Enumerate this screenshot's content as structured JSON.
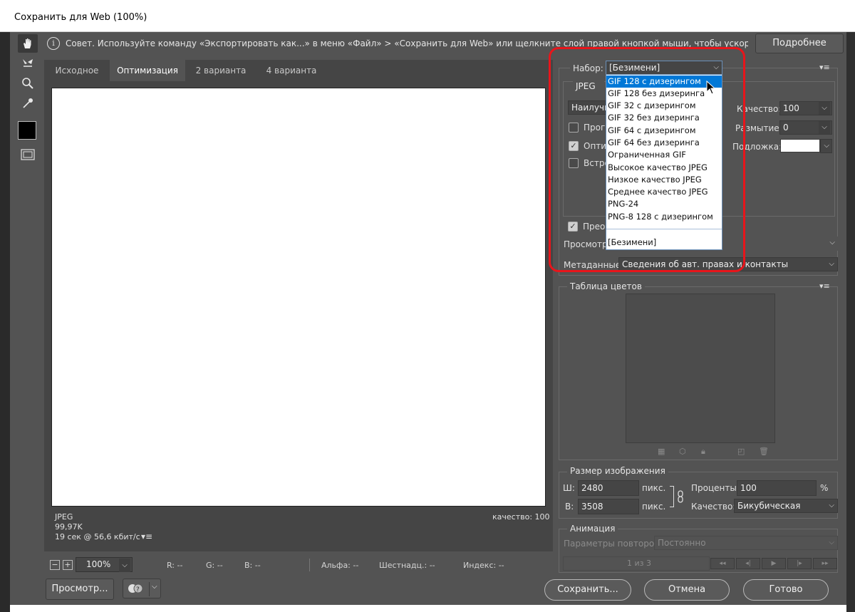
{
  "window": {
    "title": "Сохранить для Web (100%)"
  },
  "toolbar": {
    "tools": [
      {
        "icon": "hand-tool-icon",
        "glyph": "✋"
      },
      {
        "icon": "slice-select-tool-icon",
        "glyph": "⤡"
      },
      {
        "icon": "zoom-tool-icon",
        "glyph": "🔍"
      },
      {
        "icon": "eyedropper-tool-icon",
        "glyph": "✎"
      },
      {
        "icon": "eyedropper-color-swatch",
        "glyph": ""
      },
      {
        "icon": "toggle-slices-icon",
        "glyph": "▦"
      }
    ],
    "swatch_color": "#000000"
  },
  "tip": {
    "icon": "i",
    "text": "Совет. Используйте команду «Экспортировать как...» в меню «Файл» > «Сохранить для Web» или щелкните слой правой кнопкой мыши, чтобы ускорить экспорт ресурсов",
    "more_button": "Подробнее"
  },
  "tabs": [
    {
      "label": "Исходное",
      "active": false
    },
    {
      "label": "Оптимизация",
      "active": true
    },
    {
      "label": "2 варианта",
      "active": false
    },
    {
      "label": "4 варианта",
      "active": false
    }
  ],
  "canvas_info": {
    "format": "JPEG",
    "size": "99,97K",
    "download_time": "19 сек @ 56,6 кбит/с",
    "quality": "качество: 100"
  },
  "statusbar": {
    "zoom_minus": "−",
    "zoom_plus": "+",
    "zoom_value": "100%",
    "r": "R: --",
    "g": "G: --",
    "b": "B: --",
    "alpha": "Альфа: --",
    "hex": "Шестнадц.: --",
    "index": "Индекс: --"
  },
  "bottom_left": {
    "preview_button": "Просмотр...",
    "browser_icon": "browser-preview-icon"
  },
  "preset": {
    "label": "Набор:",
    "value": "[Безимени]",
    "format_value": "JPEG",
    "compression_value": "Наилучш",
    "quality_label": "Качество:",
    "quality_value": "100",
    "blur_label": "Размытие:",
    "blur_value": "0",
    "matte_label": "Подложка:",
    "matte_color": "#ffffff",
    "progressive_label": "Прогр",
    "optimized_label": "Оптим",
    "embed_label": "Встро",
    "convert_label": "Преоб",
    "preview_label": "Просмотр:",
    "metadata_label": "Метаданные:",
    "metadata_value": "Сведения об авт. правах и контакты"
  },
  "dropdown": {
    "options": [
      {
        "label": "GIF 128 с дизерингом",
        "highlighted": true
      },
      {
        "label": "GIF 128 без дизеринга",
        "highlighted": false
      },
      {
        "label": "GIF 32 с дизерингом",
        "highlighted": false
      },
      {
        "label": "GIF 32 без дизеринга",
        "highlighted": false
      },
      {
        "label": "GIF 64 с дизерингом",
        "highlighted": false
      },
      {
        "label": "GIF 64 без дизеринга",
        "highlighted": false
      },
      {
        "label": "Ограниченная GIF",
        "highlighted": false
      },
      {
        "label": "Высокое качество JPEG",
        "highlighted": false
      },
      {
        "label": "Низкое качество JPEG",
        "highlighted": false
      },
      {
        "label": "Среднее качество JPEG",
        "highlighted": false
      },
      {
        "label": "PNG-24",
        "highlighted": false
      },
      {
        "label": "PNG-8 128 с дизерингом",
        "highlighted": false
      }
    ],
    "footer": "[Безимени]"
  },
  "color_table": {
    "title": "Таблица цветов",
    "icons": [
      "web-shift-icon",
      "map-color-icon",
      "lock-color-icon",
      "new-color-icon",
      "trash-icon"
    ]
  },
  "image_size": {
    "title": "Размер изображения",
    "width_label": "Ш:",
    "width_value": "2480",
    "height_label": "В:",
    "height_value": "3508",
    "unit": "пикс.",
    "percent_label": "Проценты:",
    "percent_value": "100",
    "percent_sign": "%",
    "quality_label": "Качество:",
    "quality_value": "Бикубическая"
  },
  "animation": {
    "title": "Анимация",
    "loop_label": "Параметры повторов:",
    "loop_value": "Постоянно",
    "frame_counter": "1 из 3",
    "controls": [
      "◂◂",
      "◂|",
      "▶",
      "|▸",
      "▸▸"
    ]
  },
  "buttons": {
    "save": "Сохранить...",
    "cancel": "Отмена",
    "done": "Готово"
  },
  "colors": {
    "highlight": "#0078d7",
    "annotation": "#e8151b"
  }
}
